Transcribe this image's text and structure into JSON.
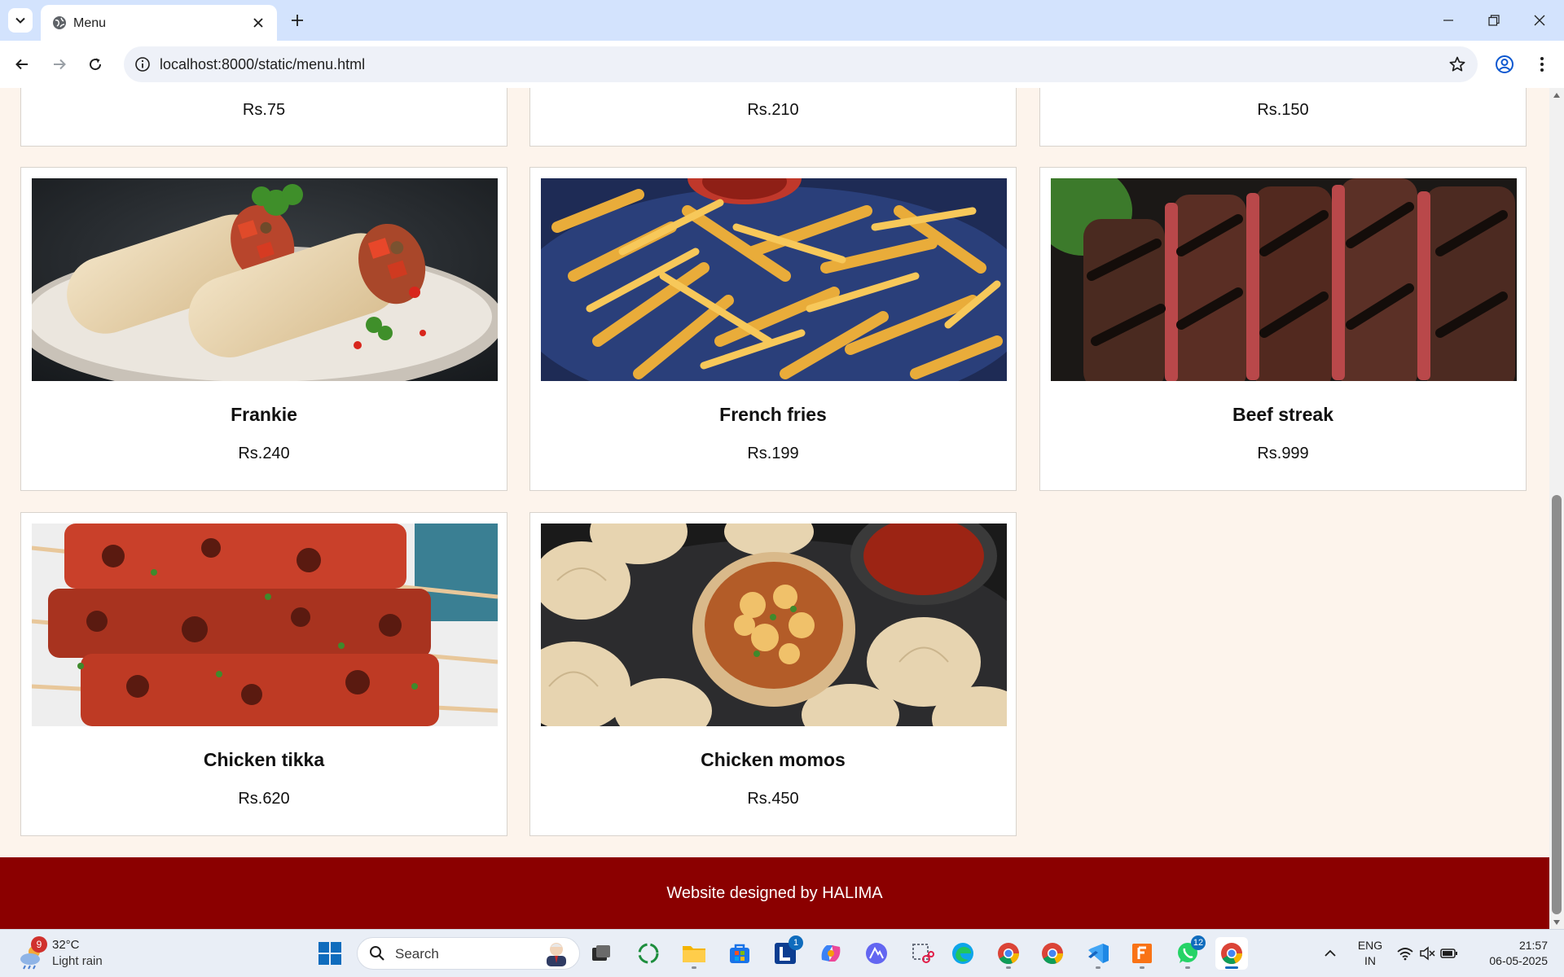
{
  "browser": {
    "tab_title": "Menu",
    "url": "localhost:8000/static/menu.html"
  },
  "menu": {
    "partial_prices": [
      "Rs.75",
      "Rs.210",
      "Rs.150"
    ],
    "items": [
      {
        "name": "Frankie",
        "price": "Rs.240"
      },
      {
        "name": "French fries",
        "price": "Rs.199"
      },
      {
        "name": "Beef streak",
        "price": "Rs.999"
      },
      {
        "name": "Chicken tikka",
        "price": "Rs.620"
      },
      {
        "name": "Chicken momos",
        "price": "Rs.450"
      }
    ]
  },
  "footer": {
    "text": "Website designed by HALIMA"
  },
  "taskbar": {
    "weather_badge": "9",
    "weather_temp": "32°C",
    "weather_desc": "Light rain",
    "search_label": "Search",
    "badges": {
      "app_l": "1",
      "whatsapp": "12"
    },
    "lang_line1": "ENG",
    "lang_line2": "IN",
    "time": "21:57",
    "date": "06-05-2025"
  },
  "colors": {
    "footer_bg": "#8b0000",
    "page_bg": "#fdf4ec",
    "chrome_bg": "#d3e3fd"
  }
}
